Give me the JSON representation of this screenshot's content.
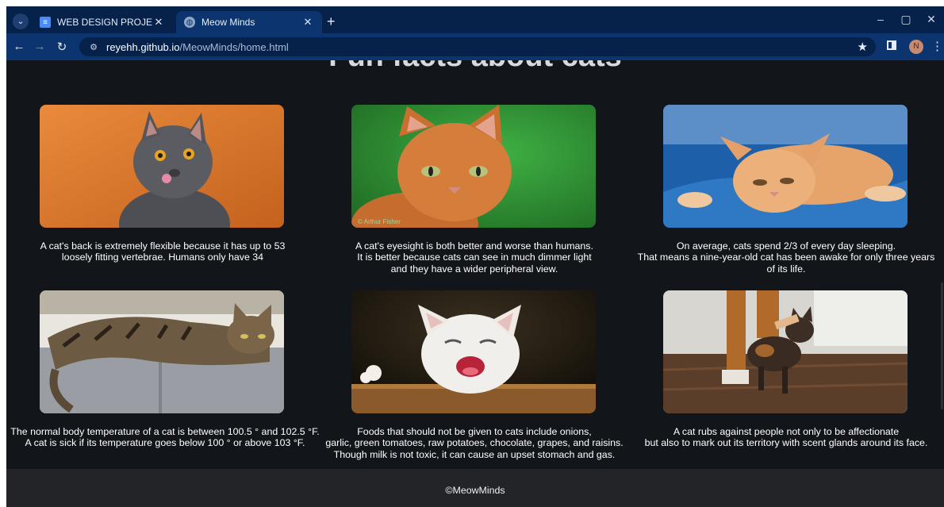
{
  "browser": {
    "tabs": [
      {
        "title": "WEB DESIGN PROJECT REPORT",
        "active": false
      },
      {
        "title": "Meow Minds",
        "active": true
      }
    ],
    "url_domain": "reyehh.github.io",
    "url_path": "/MeowMinds/home.html",
    "profile_initial": "N"
  },
  "page": {
    "heading": "Fun facts about cats",
    "facts": [
      {
        "lines": [
          "A cat's back is extremely flexible because it has up to 53",
          "loosely fitting vertebrae. Humans only have 34"
        ]
      },
      {
        "lines": [
          "A cat's eyesight is both better and worse than humans.",
          "It is better because cats can see in much dimmer light",
          "and they have a wider peripheral view."
        ]
      },
      {
        "lines": [
          "On average, cats spend 2/3 of every day sleeping.",
          "That means a nine-year-old cat has been awake for only three years",
          "of its life."
        ]
      },
      {
        "lines": [
          "The normal body temperature of a cat is between 100.5 ° and 102.5 °F.",
          "A cat is sick if its temperature goes below 100 ° or above 103 °F."
        ]
      },
      {
        "lines": [
          "Foods that should not be given to cats include onions,",
          "garlic, green tomatoes, raw potatoes, chocolate, grapes, and raisins.",
          "Though milk is not toxic, it can cause an upset stomach and gas."
        ]
      },
      {
        "lines": [
          "A cat rubs against people not only to be affectionate",
          "but also to mark out its territory with scent glands around its face."
        ]
      }
    ],
    "photo_watermark": "© Arthur Fisher",
    "footer": "©MeowMinds"
  }
}
